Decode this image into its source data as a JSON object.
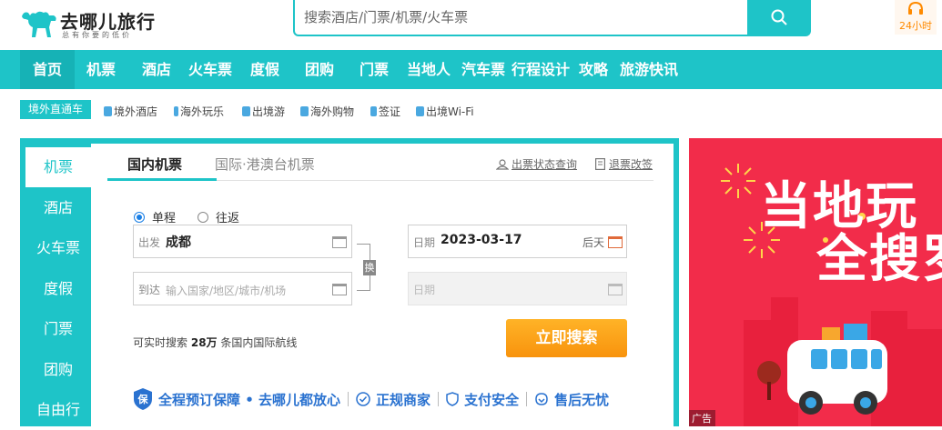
{
  "brand": {
    "name": "去哪儿旅行",
    "slogan": "总有你要的低价",
    "color": "#1ec4c8"
  },
  "search": {
    "placeholder": "搜索酒店/门票/机票/火车票"
  },
  "service": {
    "label": "24小时"
  },
  "nav": {
    "items": [
      "首页",
      "机票",
      "酒店",
      "火车票",
      "度假",
      "团购",
      "门票",
      "当地人",
      "汽车票",
      "行程设计",
      "攻略",
      "旅游快讯"
    ],
    "active": "首页"
  },
  "subnav": {
    "tag": "境外直通车",
    "items": [
      "境外酒店",
      "海外玩乐",
      "出境游",
      "海外购物",
      "签证",
      "出境Wi-Fi"
    ]
  },
  "booking": {
    "categories": [
      "机票",
      "酒店",
      "火车票",
      "度假",
      "门票",
      "团购",
      "自由行"
    ],
    "active_category": "机票",
    "tabs": [
      "国内机票",
      "国际·港澳台机票"
    ],
    "active_tab": "国内机票",
    "links": {
      "status": "出票状态查询",
      "refund": "退票改签"
    },
    "trip_types": [
      "单程",
      "往返"
    ],
    "selected_trip": "单程",
    "from_label": "出发",
    "from_value": "成都",
    "to_label": "到达",
    "to_placeholder": "输入国家/地区/城市/机场",
    "swap_label": "换",
    "date_label": "日期",
    "date_value": "2023-03-17",
    "date_hint": "后天",
    "return_label": "日期",
    "info_prefix": "可实时搜索",
    "info_count": "28万",
    "info_suffix": "条国内国际航线",
    "search_button": "立即搜索",
    "guarantees": [
      "全程预订保障 • 去哪儿都放心",
      "正规商家",
      "支付安全",
      "售后无忧"
    ]
  },
  "ad": {
    "headline_line1": "当地玩",
    "headline_line2": "全搜罗",
    "badge": "广告"
  }
}
